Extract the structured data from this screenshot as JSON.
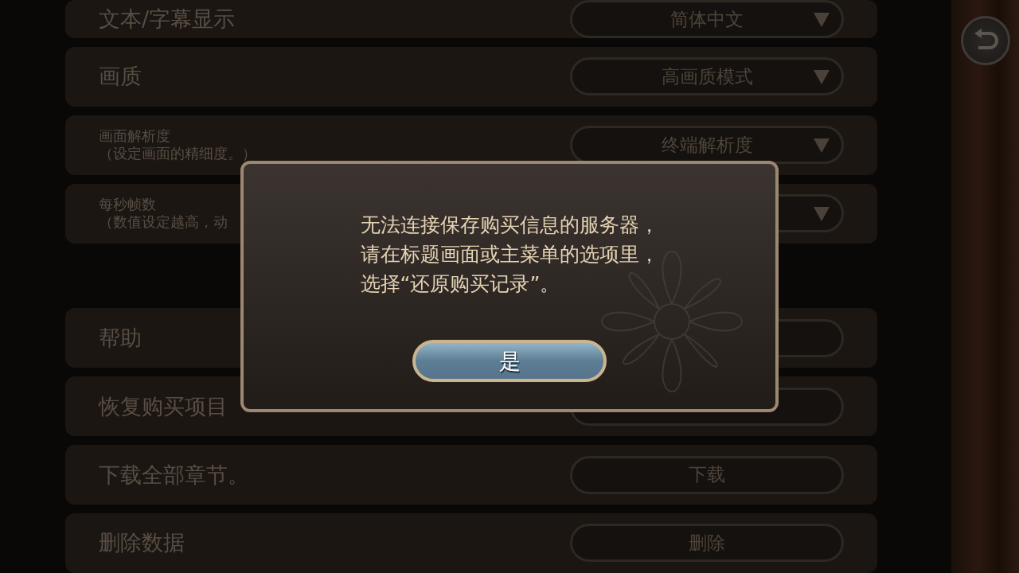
{
  "settings": [
    {
      "kind": "dropdown",
      "label": "文本/字幕显示",
      "value": "简体中文"
    },
    {
      "kind": "dropdown",
      "label": "画质",
      "value": "高画质模式"
    },
    {
      "kind": "dropdown",
      "label": "画面解析度",
      "sublabel": "（设定画面的精细度。）",
      "value": "终端解析度"
    },
    {
      "kind": "dropdown",
      "label": "每秒帧数",
      "sublabel": "（数值设定越高，动"
    },
    {
      "kind": "spacer"
    },
    {
      "kind": "button",
      "label": "帮助"
    },
    {
      "kind": "button",
      "label": "恢复购买项目"
    },
    {
      "kind": "button",
      "label": "下载全部章节。",
      "value": "下载"
    },
    {
      "kind": "button",
      "label": "删除数据",
      "value": "删除"
    }
  ],
  "dialog": {
    "message": [
      "无法连接保存购买信息的服务器，",
      "请在标题画面或主菜单的选项里，",
      "选择“还原购买记录”。"
    ],
    "button": "是"
  }
}
